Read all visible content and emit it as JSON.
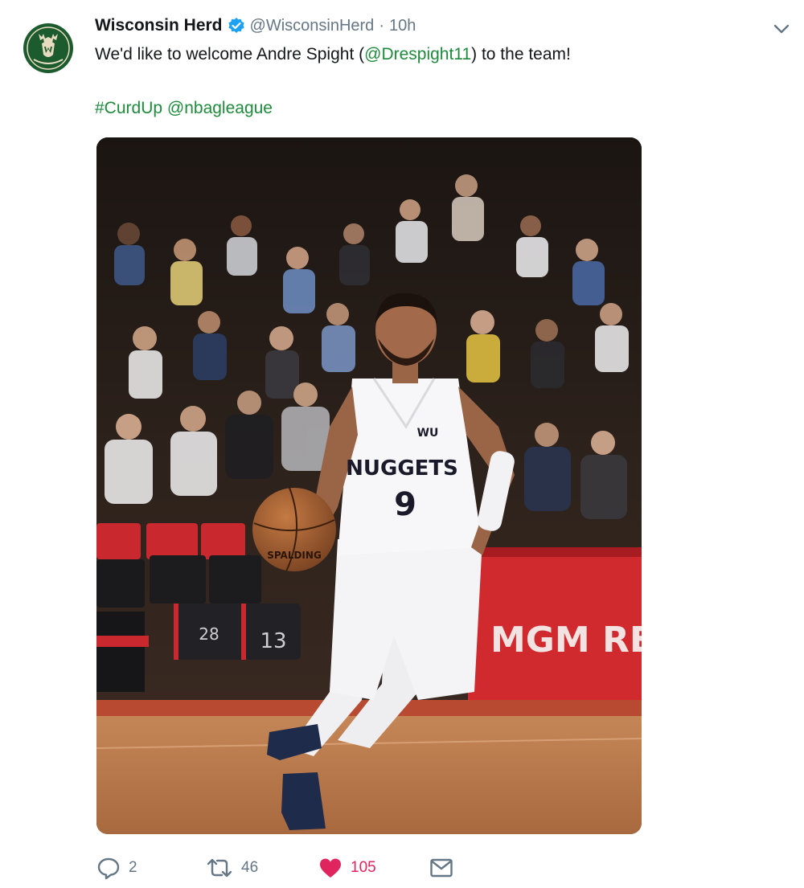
{
  "tweet": {
    "display_name": "Wisconsin Herd",
    "handle": "@WisconsinHerd",
    "separator": "·",
    "time": "10h",
    "text_before": "We'd like to welcome Andre Spight (",
    "mention": "@Drespight11",
    "text_after": ") to the team!",
    "hashtag": "#CurdUp",
    "mention2": "@nbagleague"
  },
  "photo": {
    "jersey_text": "NUGGETS",
    "jersey_number": "9",
    "jersey_logo": "WU",
    "banner_text": "MGM RESO",
    "ball_text": "SPALDING",
    "seat_numbers": [
      "28",
      "13"
    ]
  },
  "actions": {
    "reply_count": "2",
    "retweet_count": "46",
    "like_count": "105"
  },
  "icons": {
    "verified": "verified-badge-icon",
    "chevron": "chevron-down-icon",
    "reply": "reply-icon",
    "retweet": "retweet-icon",
    "like": "heart-icon",
    "dm": "envelope-icon"
  },
  "colors": {
    "link": "#1f8a3c",
    "verified": "#1da1f2",
    "like": "#e0245e",
    "muted": "#657786"
  }
}
